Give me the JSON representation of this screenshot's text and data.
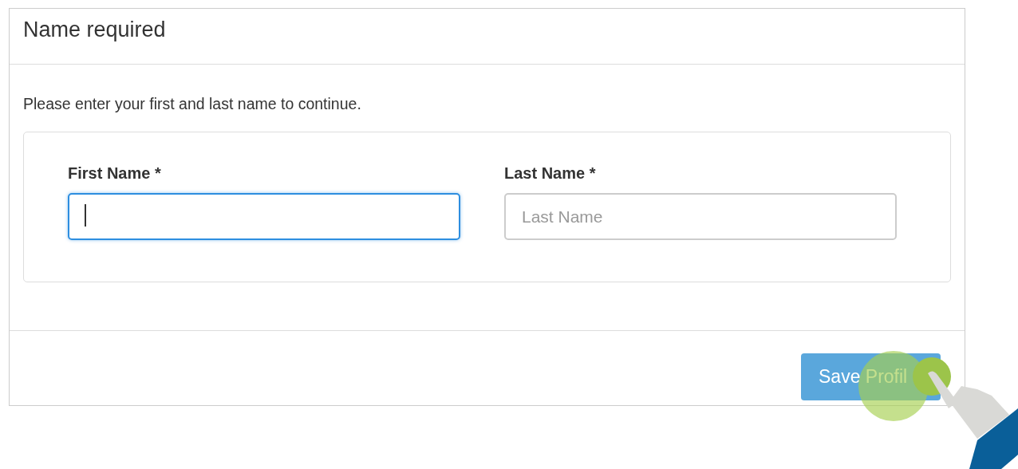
{
  "dialog": {
    "title": "Name required",
    "message": "Please enter your first and last name to continue.",
    "fields": [
      {
        "label": "First Name *",
        "focused": true
      },
      {
        "label": "Last Name *",
        "placeholder": "Last Name",
        "focused": false
      }
    ],
    "buttons": [
      {
        "label": "Save Profil"
      }
    ]
  },
  "overlay": {
    "kind": "tap-gesture"
  }
}
